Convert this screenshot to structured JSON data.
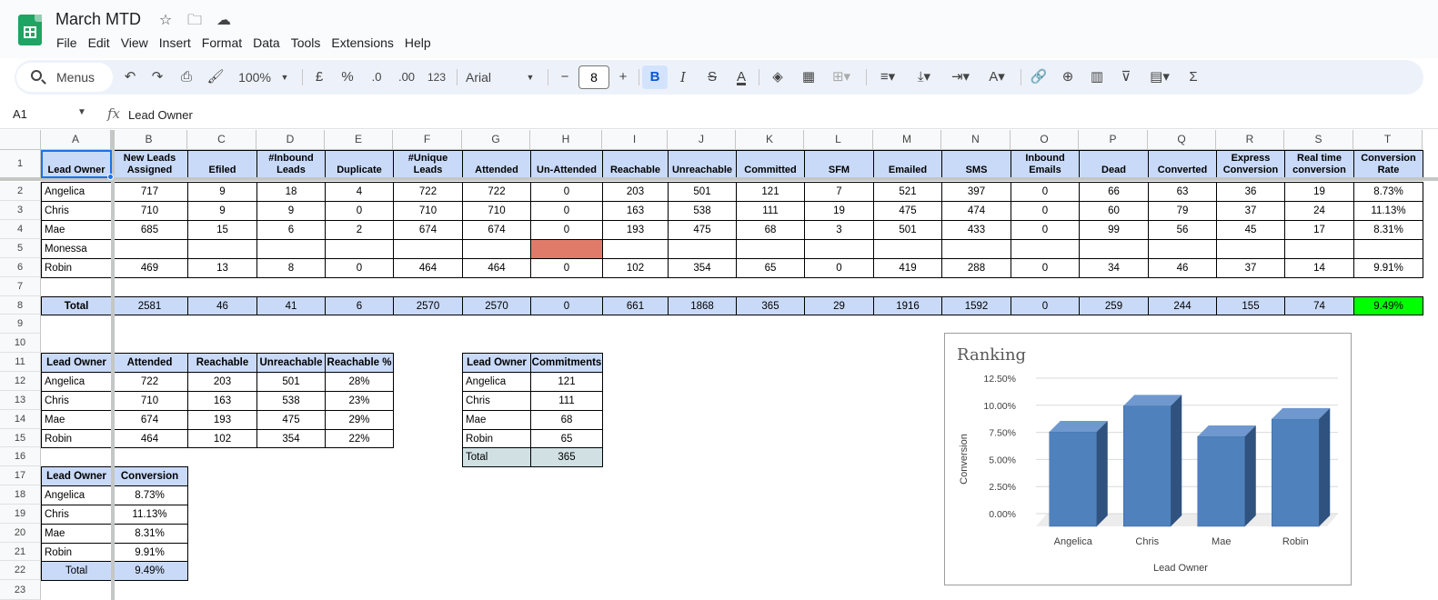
{
  "app": {
    "title": "March MTD",
    "menus": [
      "File",
      "Edit",
      "View",
      "Insert",
      "Format",
      "Data",
      "Tools",
      "Extensions",
      "Help"
    ]
  },
  "toolbar": {
    "search_label": "Menus",
    "zoom": "100%",
    "currency": "£",
    "percent": "%",
    "dec_decrease": ".0",
    "dec_increase": ".00",
    "number_format": "123",
    "font": "Arial",
    "font_size": "8"
  },
  "formula_bar": {
    "cell_ref": "A1",
    "fx": "fx",
    "value": "Lead Owner"
  },
  "columns": [
    "A",
    "B",
    "C",
    "D",
    "E",
    "F",
    "G",
    "H",
    "I",
    "J",
    "K",
    "L",
    "M",
    "N",
    "O",
    "P",
    "Q",
    "R",
    "S",
    "T"
  ],
  "rows": [
    "1",
    "2",
    "3",
    "4",
    "5",
    "6",
    "7",
    "8",
    "9",
    "10",
    "11",
    "12",
    "13",
    "14",
    "15",
    "16",
    "17",
    "18",
    "19",
    "20",
    "21",
    "22",
    "23"
  ],
  "main_table": {
    "headers": [
      "Lead Owner",
      "New Leads Assigned",
      "Efiled",
      "#Inbound Leads",
      "Duplicate",
      "#Unique Leads",
      "Attended",
      "Un-Attended",
      "Reachable",
      "Unreachable",
      "Committed",
      "SFM",
      "Emailed",
      "SMS",
      "Inbound Emails",
      "Dead",
      "Converted",
      "Express Conversion",
      "Real time conversion",
      "Conversion Rate"
    ],
    "rows": [
      [
        "Angelica",
        "717",
        "9",
        "18",
        "4",
        "722",
        "722",
        "0",
        "203",
        "501",
        "121",
        "7",
        "521",
        "397",
        "0",
        "66",
        "63",
        "36",
        "19",
        "8.73%"
      ],
      [
        "Chris",
        "710",
        "9",
        "9",
        "0",
        "710",
        "710",
        "0",
        "163",
        "538",
        "111",
        "19",
        "475",
        "474",
        "0",
        "60",
        "79",
        "37",
        "24",
        "11.13%"
      ],
      [
        "Mae",
        "685",
        "15",
        "6",
        "2",
        "674",
        "674",
        "0",
        "193",
        "475",
        "68",
        "3",
        "501",
        "433",
        "0",
        "99",
        "56",
        "45",
        "17",
        "8.31%"
      ],
      [
        "Monessa",
        "",
        "",
        "",
        "",
        "",
        "",
        "",
        "",
        "",
        "",
        "",
        "",
        "",
        "",
        "",
        "",
        "",
        "",
        ""
      ],
      [
        "Robin",
        "469",
        "13",
        "8",
        "0",
        "464",
        "464",
        "0",
        "102",
        "354",
        "65",
        "0",
        "419",
        "288",
        "0",
        "34",
        "46",
        "37",
        "14",
        "9.91%"
      ]
    ],
    "total": [
      "Total",
      "2581",
      "46",
      "41",
      "6",
      "2570",
      "2570",
      "0",
      "661",
      "1868",
      "365",
      "29",
      "1916",
      "1592",
      "0",
      "259",
      "244",
      "155",
      "74",
      "9.49%"
    ]
  },
  "reach_table": {
    "headers": [
      "Lead Owner",
      "Attended",
      "Reachable",
      "Unreachable",
      "Reachable %"
    ],
    "rows": [
      [
        "Angelica",
        "722",
        "203",
        "501",
        "28%"
      ],
      [
        "Chris",
        "710",
        "163",
        "538",
        "23%"
      ],
      [
        "Mae",
        "674",
        "193",
        "475",
        "29%"
      ],
      [
        "Robin",
        "464",
        "102",
        "354",
        "22%"
      ]
    ]
  },
  "commit_table": {
    "headers": [
      "Lead Owner",
      "Commitments"
    ],
    "rows": [
      [
        "Angelica",
        "121"
      ],
      [
        "Chris",
        "111"
      ],
      [
        "Mae",
        "68"
      ],
      [
        "Robin",
        "65"
      ]
    ],
    "total": [
      "Total",
      "365"
    ]
  },
  "conv_table": {
    "headers": [
      "Lead Owner",
      "Conversion"
    ],
    "rows": [
      [
        "Angelica",
        "8.73%"
      ],
      [
        "Chris",
        "11.13%"
      ],
      [
        "Mae",
        "8.31%"
      ],
      [
        "Robin",
        "9.91%"
      ]
    ],
    "total": [
      "Total",
      "9.49%"
    ]
  },
  "colors": {
    "header_blue": "#c9daf8",
    "unattended_red": "#e07b6a",
    "conversion_green": "#00ff00",
    "total_gray": "#d0e0e3",
    "bar": "#4f81bd"
  },
  "chart_data": {
    "type": "bar",
    "title": "Ranking",
    "categories": [
      "Angelica",
      "Chris",
      "Mae",
      "Robin"
    ],
    "values": [
      8.73,
      11.13,
      8.31,
      9.91
    ],
    "xlabel": "Lead Owner",
    "ylabel": "Conversion",
    "yticks": [
      "0.00%",
      "2.50%",
      "5.00%",
      "7.50%",
      "10.00%",
      "12.50%"
    ],
    "ylim": [
      0,
      12.5
    ],
    "grid": true
  }
}
